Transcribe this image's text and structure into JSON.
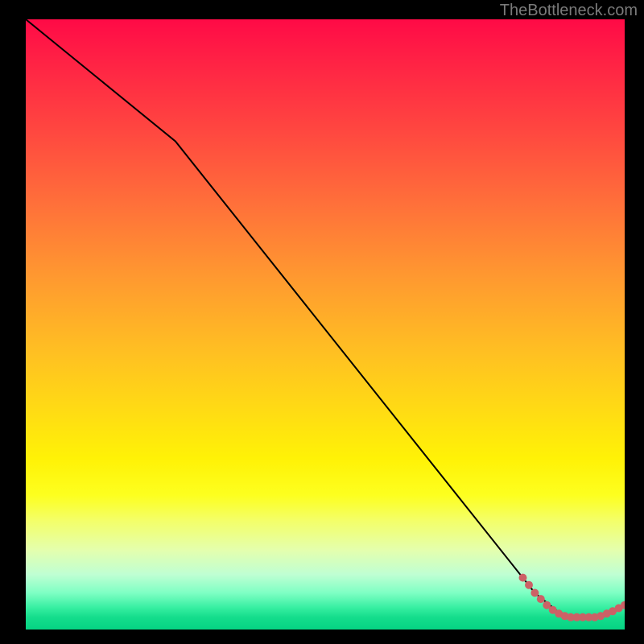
{
  "watermark": "TheBottleneck.com",
  "colors": {
    "marker": "#cc6166",
    "curve": "#000000"
  },
  "chart_data": {
    "type": "line",
    "title": "",
    "xlabel": "",
    "ylabel": "",
    "xlim": [
      0,
      100
    ],
    "ylim": [
      0,
      100
    ],
    "series": [
      {
        "name": "curve",
        "x": [
          0,
          25,
          85,
          90,
          95,
          100
        ],
        "y": [
          100,
          80,
          6,
          2,
          2,
          4
        ]
      },
      {
        "name": "highlighted-segment",
        "note": "thick salmon markers along the curve near the minimum",
        "x": [
          83,
          84,
          85,
          86,
          87,
          88,
          89,
          90,
          91,
          92,
          93,
          94,
          95,
          96,
          97,
          98,
          99,
          100
        ],
        "y": [
          8.5,
          7.3,
          6.0,
          5.0,
          4.0,
          3.2,
          2.6,
          2.2,
          2.0,
          2.0,
          2.0,
          2.0,
          2.0,
          2.2,
          2.6,
          3.0,
          3.5,
          4.0
        ]
      }
    ]
  }
}
